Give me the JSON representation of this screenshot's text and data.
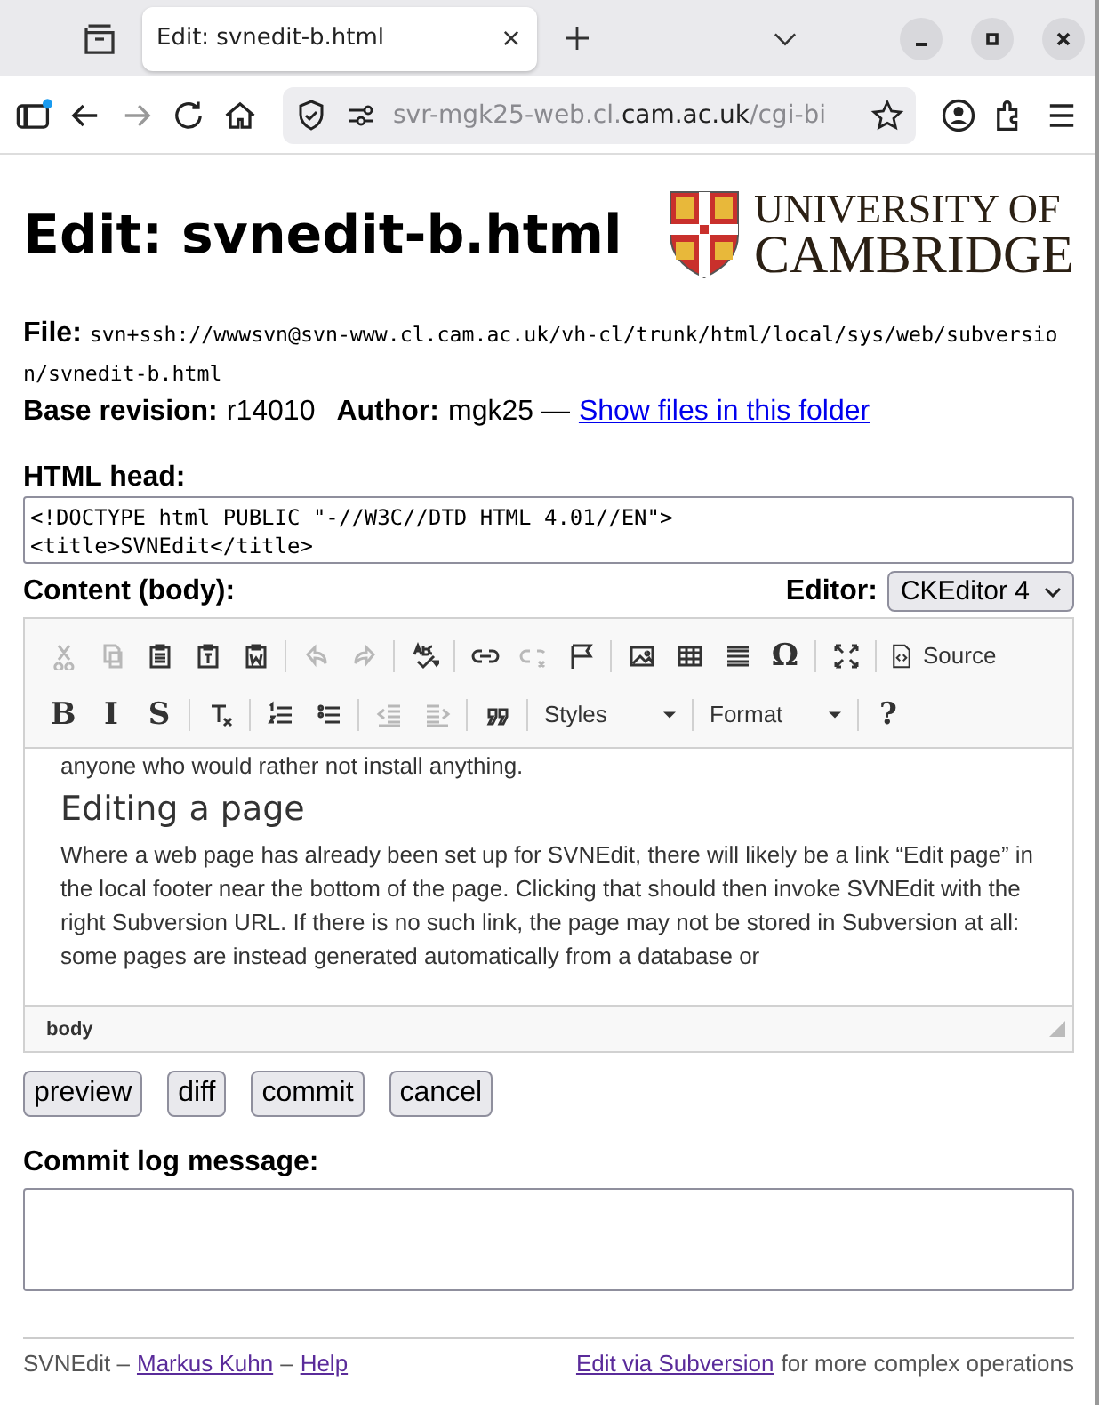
{
  "browser": {
    "tabs": [
      {
        "title": "Edit: svnedit-b.html",
        "selected": true
      }
    ],
    "url": {
      "host_prefix": "svr-mgk25-web.cl.",
      "domain": "cam.ac.uk",
      "path": "/cgi-bi"
    }
  },
  "page": {
    "title": "Edit: svnedit-b.html",
    "logo": {
      "line_1": "UNIVERSITY OF",
      "line_2": "CAMBRIDGE"
    },
    "file": {
      "label": "File:",
      "value": "svn+ssh://wwwsvn@svn-www.cl.cam.ac.uk/vh-cl/trunk/html/local/sys/web/subversion/svnedit-b.html"
    },
    "base_revision": {
      "label": "Base revision:",
      "value": "r14010"
    },
    "author": {
      "label": "Author:",
      "value": "mgk25 —"
    },
    "folder_link": "Show files in this folder",
    "html_head": {
      "label": "HTML head:",
      "lines": [
        "<!DOCTYPE html PUBLIC \"-//W3C//DTD HTML 4.01//EN\">",
        "<title>SVNEdit</title>"
      ]
    },
    "content": {
      "label": "Content (body):",
      "editor_label": "Editor:",
      "editor_value": "CKEditor 4",
      "toolbar": [
        [
          [
            {
              "kind": "icon",
              "disabled": true
            },
            {
              "kind": "icon",
              "disabled": true
            },
            {
              "kind": "icon",
              "disabled": false
            },
            {
              "kind": "icon",
              "disabled": false
            },
            {
              "kind": "icon",
              "disabled": false
            }
          ],
          [
            {
              "kind": "icon",
              "disabled": true
            },
            {
              "kind": "icon",
              "disabled": true
            }
          ],
          [
            {
              "kind": "icon",
              "disabled": false
            }
          ],
          [
            {
              "kind": "icon",
              "disabled": false
            },
            {
              "kind": "icon",
              "disabled": true
            },
            {
              "kind": "icon",
              "disabled": false
            }
          ],
          [
            {
              "kind": "icon",
              "disabled": false
            },
            {
              "kind": "icon",
              "disabled": false
            },
            {
              "kind": "icon",
              "disabled": false
            },
            {
              "kind": "glyph",
              "text": "Ω",
              "disabled": false
            }
          ],
          [
            {
              "kind": "icon",
              "disabled": false
            }
          ],
          [
            {
              "kind": "labeled",
              "label": "Source",
              "disabled": false
            }
          ]
        ],
        [
          [
            {
              "kind": "glyph",
              "text": "B",
              "disabled": false
            },
            {
              "kind": "glyph",
              "text": "I",
              "disabled": false
            },
            {
              "kind": "glyph",
              "text": "S",
              "disabled": false
            }
          ],
          [
            {
              "kind": "icon",
              "disabled": false
            }
          ],
          [
            {
              "kind": "icon",
              "disabled": false
            },
            {
              "kind": "icon",
              "disabled": false
            }
          ],
          [
            {
              "kind": "icon",
              "disabled": true
            },
            {
              "kind": "icon",
              "disabled": true
            }
          ],
          [
            {
              "kind": "icon",
              "disabled": false
            }
          ],
          [
            {
              "kind": "combo",
              "label": "Styles",
              "disabled": false
            }
          ],
          [
            {
              "kind": "combo",
              "label": "Format",
              "disabled": false
            }
          ],
          [
            {
              "kind": "glyph",
              "text": "?",
              "disabled": false
            }
          ]
        ]
      ],
      "body": [
        {
          "kind": "p",
          "text": "anyone who would rather not install anything."
        },
        {
          "kind": "h2",
          "text": "Editing a page"
        },
        {
          "kind": "p",
          "text": "Where a web page has already been set up for SVNEdit, there will likely be a link “Edit page” in the local footer near the bottom of the page. Clicking that should then invoke SVNEdit with the right Subversion URL. If there is no such link, the page may not be stored in Subversion at all: some pages are instead generated automatically from a database or"
        }
      ],
      "path": "body"
    },
    "buttons": [
      "preview",
      "diff",
      "commit",
      "cancel"
    ],
    "commit_log": {
      "label": "Commit log message:"
    },
    "footer": {
      "left": [
        {
          "kind": "text",
          "text": "SVNEdit –"
        },
        {
          "kind": "link",
          "text": "Markus Kuhn"
        },
        {
          "kind": "text",
          "text": "–"
        },
        {
          "kind": "link",
          "text": "Help"
        }
      ],
      "right": [
        {
          "kind": "link",
          "text": "Edit via Subversion"
        },
        {
          "kind": "text",
          "text": "for more complex operations"
        }
      ]
    }
  }
}
